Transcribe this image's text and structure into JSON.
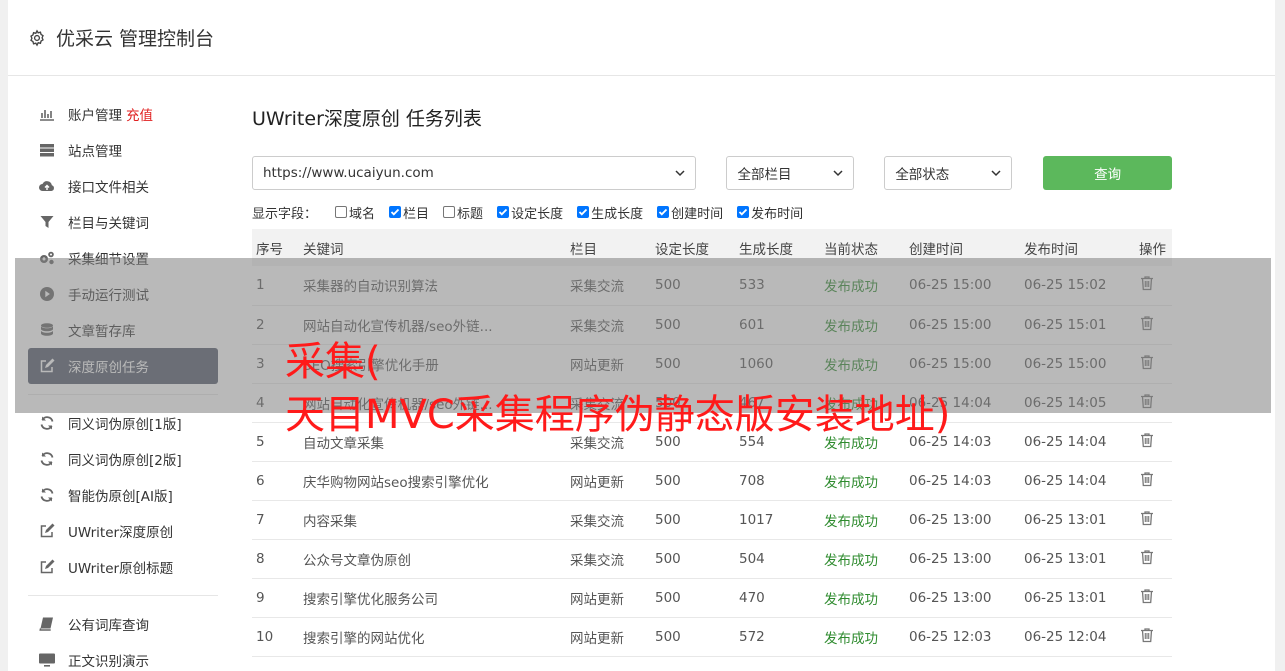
{
  "app": {
    "title": "优采云 管理控制台",
    "icon": "gear-icon"
  },
  "sidebar": {
    "items": [
      {
        "label": "账户管理",
        "badge": "充值",
        "icon": "bar-chart-icon"
      },
      {
        "label": "站点管理",
        "icon": "server-icon"
      },
      {
        "label": "接口文件相关",
        "icon": "cloud-upload-icon"
      },
      {
        "label": "栏目与关键词",
        "icon": "filter-icon"
      },
      {
        "label": "采集细节设置",
        "icon": "cogs-icon"
      },
      {
        "label": "手动运行测试",
        "icon": "play-circle-icon"
      },
      {
        "label": "文章暂存库",
        "icon": "database-icon"
      },
      {
        "label": "深度原创任务",
        "icon": "edit-icon",
        "active": true
      },
      {
        "label": "同义词伪原创[1版]",
        "icon": "refresh-icon"
      },
      {
        "label": "同义词伪原创[2版]",
        "icon": "refresh-icon"
      },
      {
        "label": "智能伪原创[AI版]",
        "icon": "refresh-icon"
      },
      {
        "label": "UWriter深度原创",
        "icon": "edit-icon"
      },
      {
        "label": "UWriter原创标题",
        "icon": "edit-icon"
      },
      {
        "label": "公有词库查询",
        "icon": "book-icon"
      },
      {
        "label": "正文识别演示",
        "icon": "monitor-icon"
      }
    ]
  },
  "main": {
    "title": "UWriter深度原创 任务列表",
    "filters": {
      "site": "https://www.ucaiyun.com",
      "column": "全部栏目",
      "status": "全部状态",
      "query_label": "查询"
    },
    "fields": {
      "label": "显示字段：",
      "options": [
        {
          "label": "域名",
          "checked": false
        },
        {
          "label": "栏目",
          "checked": true
        },
        {
          "label": "标题",
          "checked": false
        },
        {
          "label": "设定长度",
          "checked": true
        },
        {
          "label": "生成长度",
          "checked": true
        },
        {
          "label": "创建时间",
          "checked": true
        },
        {
          "label": "发布时间",
          "checked": true
        }
      ]
    },
    "table": {
      "headers": [
        "序号",
        "关键词",
        "栏目",
        "设定长度",
        "生成长度",
        "当前状态",
        "创建时间",
        "发布时间",
        "操作"
      ],
      "rows": [
        [
          "1",
          "采集器的自动识别算法",
          "采集交流",
          "500",
          "533",
          "发布成功",
          "06-25 15:00",
          "06-25 15:02"
        ],
        [
          "2",
          "网站自动化宣传机器/seo外链...",
          "采集交流",
          "500",
          "601",
          "发布成功",
          "06-25 15:00",
          "06-25 15:01"
        ],
        [
          "3",
          "SEO搜索引擎优化手册",
          "网站更新",
          "500",
          "1060",
          "发布成功",
          "06-25 15:00",
          "06-25 15:00"
        ],
        [
          "4",
          "网站自动化宣传机器/seo外链...",
          "采集交流",
          "500",
          "467",
          "发布成功",
          "06-25 14:04",
          "06-25 14:05"
        ],
        [
          "5",
          "自动文章采集",
          "采集交流",
          "500",
          "554",
          "发布成功",
          "06-25 14:03",
          "06-25 14:04"
        ],
        [
          "6",
          "庆华购物网站seo搜索引擎优化",
          "网站更新",
          "500",
          "708",
          "发布成功",
          "06-25 14:03",
          "06-25 14:04"
        ],
        [
          "7",
          "内容采集",
          "采集交流",
          "500",
          "1017",
          "发布成功",
          "06-25 13:00",
          "06-25 13:01"
        ],
        [
          "8",
          "公众号文章伪原创",
          "采集交流",
          "500",
          "504",
          "发布成功",
          "06-25 13:00",
          "06-25 13:01"
        ],
        [
          "9",
          "搜索引擎优化服务公司",
          "网站更新",
          "500",
          "470",
          "发布成功",
          "06-25 13:00",
          "06-25 13:01"
        ],
        [
          "10",
          "搜索引擎的网站优化",
          "网站更新",
          "500",
          "572",
          "发布成功",
          "06-25 12:03",
          "06-25 12:04"
        ]
      ],
      "action_icon": "trash-icon"
    }
  },
  "overlay": {
    "line1": "采集(",
    "line2": "天目MVC采集程序伪静态版安装地址)"
  },
  "colors": {
    "accent_green": "#5cb85c",
    "status_ok": "#2e8b2e",
    "active_bg": "#525a6a",
    "recharge": "#e02020",
    "overlay_text": "#ff1a1a"
  }
}
